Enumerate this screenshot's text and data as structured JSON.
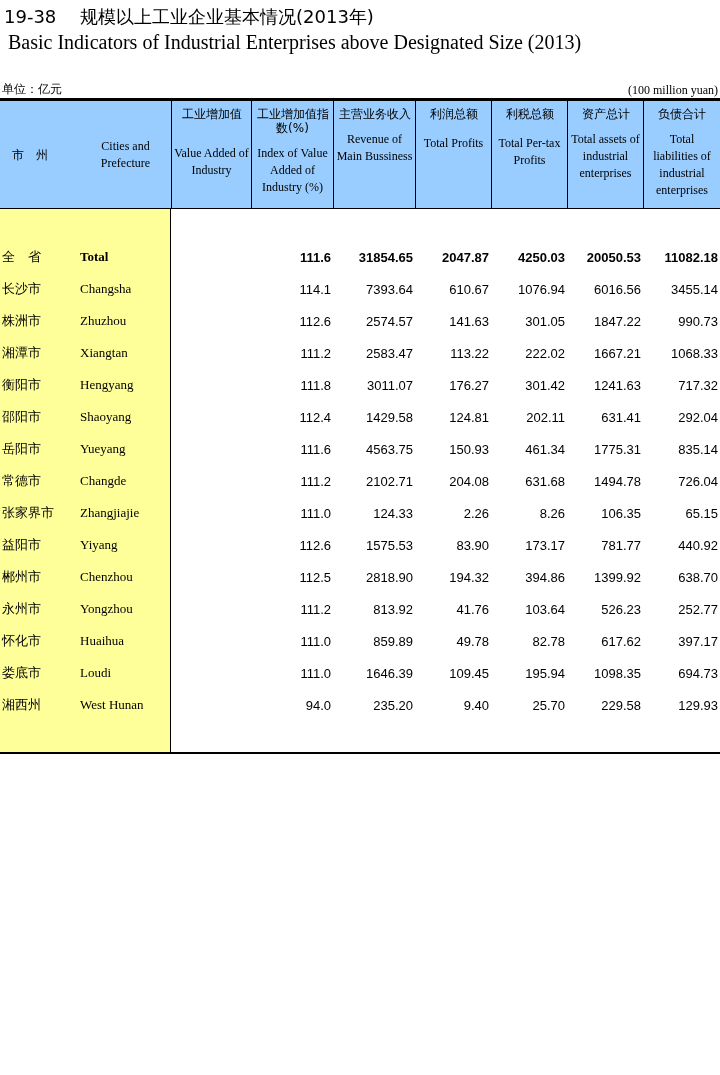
{
  "title_cn": "19-38　 规模以上工业企业基本情况(2013年)",
  "title_en": "Basic Indicators of Industrial Enterprises above Designated Size (2013)",
  "unit_cn": "单位：亿元",
  "unit_en": "(100 million yuan)",
  "columns": [
    {
      "cn": "市　州"
    },
    {
      "en": "Cities and Prefecture"
    },
    {
      "cn": "工业增加值",
      "en": "Value Added of Industry"
    },
    {
      "cn": "工业增加值指数(%)",
      "en": "Index of Value Added of Industry (%)"
    },
    {
      "cn": "主营业务收入",
      "en": "Revenue of Main Bussiness"
    },
    {
      "cn": "利润总额",
      "en": "Total Profits"
    },
    {
      "cn": "利税总额",
      "en": "Total Per-tax Profits"
    },
    {
      "cn": "资产总计",
      "en": "Total assets of industrial enterprises"
    },
    {
      "cn": "负债合计",
      "en": "Total liabilities of industrial enterprises"
    }
  ],
  "rows": [
    {
      "kind": "total",
      "name_cn": "全　省",
      "name_en": "Total",
      "values": [
        "111.6",
        "31854.65",
        "2047.87",
        "4250.03",
        "20050.53",
        "11082.18"
      ]
    },
    {
      "kind": "city",
      "name_cn": "长沙市",
      "name_en": "Changsha",
      "values": [
        "114.1",
        "7393.64",
        "610.67",
        "1076.94",
        "6016.56",
        "3455.14"
      ]
    },
    {
      "kind": "city",
      "name_cn": "株洲市",
      "name_en": "Zhuzhou",
      "values": [
        "112.6",
        "2574.57",
        "141.63",
        "301.05",
        "1847.22",
        "990.73"
      ]
    },
    {
      "kind": "city",
      "name_cn": "湘潭市",
      "name_en": "Xiangtan",
      "values": [
        "111.2",
        "2583.47",
        "113.22",
        "222.02",
        "1667.21",
        "1068.33"
      ]
    },
    {
      "kind": "city",
      "name_cn": "衡阳市",
      "name_en": "Hengyang",
      "values": [
        "111.8",
        "3011.07",
        "176.27",
        "301.42",
        "1241.63",
        "717.32"
      ]
    },
    {
      "kind": "city",
      "name_cn": "邵阳市",
      "name_en": "Shaoyang",
      "values": [
        "112.4",
        "1429.58",
        "124.81",
        "202.11",
        "631.41",
        "292.04"
      ]
    },
    {
      "kind": "city",
      "name_cn": "岳阳市",
      "name_en": "Yueyang",
      "values": [
        "111.6",
        "4563.75",
        "150.93",
        "461.34",
        "1775.31",
        "835.14"
      ]
    },
    {
      "kind": "city",
      "name_cn": "常德市",
      "name_en": "Changde",
      "values": [
        "111.2",
        "2102.71",
        "204.08",
        "631.68",
        "1494.78",
        "726.04"
      ]
    },
    {
      "kind": "city",
      "name_cn": "张家界市",
      "name_en": "Zhangjiajie",
      "values": [
        "111.0",
        "124.33",
        "2.26",
        "8.26",
        "106.35",
        "65.15"
      ]
    },
    {
      "kind": "city",
      "name_cn": "益阳市",
      "name_en": "Yiyang",
      "values": [
        "112.6",
        "1575.53",
        "83.90",
        "173.17",
        "781.77",
        "440.92"
      ]
    },
    {
      "kind": "city",
      "name_cn": "郴州市",
      "name_en": "Chenzhou",
      "values": [
        "112.5",
        "2818.90",
        "194.32",
        "394.86",
        "1399.92",
        "638.70"
      ]
    },
    {
      "kind": "city",
      "name_cn": "永州市",
      "name_en": "Yongzhou",
      "values": [
        "111.2",
        "813.92",
        "41.76",
        "103.64",
        "526.23",
        "252.77"
      ]
    },
    {
      "kind": "city",
      "name_cn": "怀化市",
      "name_en": "Huaihua",
      "values": [
        "111.0",
        "859.89",
        "49.78",
        "82.78",
        "617.62",
        "397.17"
      ]
    },
    {
      "kind": "city",
      "name_cn": "娄底市",
      "name_en": "Loudi",
      "values": [
        "111.0",
        "1646.39",
        "109.45",
        "195.94",
        "1098.35",
        "694.73"
      ]
    },
    {
      "kind": "city",
      "name_cn": "湘西州",
      "name_en": "West Hunan",
      "values": [
        "94.0",
        "235.20",
        "9.40",
        "25.70",
        "229.58",
        "129.93"
      ]
    }
  ]
}
